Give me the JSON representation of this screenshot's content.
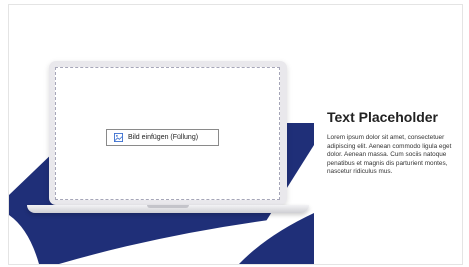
{
  "slide": {
    "placeholder_button_label": "Bild einfügen (Füllung)",
    "title": "Text Placeholder",
    "body": "Lorem ipsum dolor sit amet, consectetuer adipiscing elit. Aenean commodo ligula eget dolor. Aenean massa. Cum sociis natoque penatibus et magnis dis parturient montes, nascetur ridiculus mus."
  },
  "icons": {
    "placeholder_button": "picture-icon"
  },
  "colors": {
    "accent_navy": "#1f2f78",
    "title_text": "#222222",
    "screen_frame": "#e9e8ec"
  }
}
